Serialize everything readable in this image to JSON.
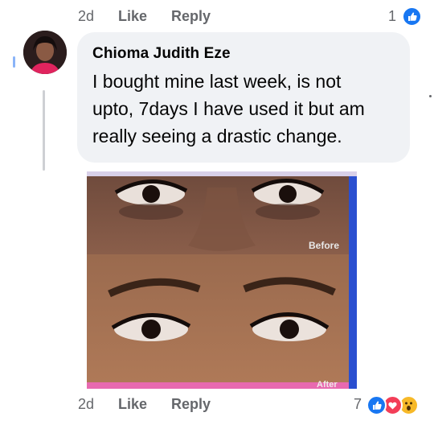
{
  "top_actions": {
    "time": "2d",
    "like": "Like",
    "reply": "Reply",
    "reaction_count": "1"
  },
  "comment": {
    "author": "Chioma Judith Eze",
    "text": "I bought mine last week, is not upto, 7days I have used it but am really seeing a drastic change.",
    "line1": "I bought mine last week, is not",
    "line2": "upto, 7days I have used it but am",
    "line3": "really seeing a drastic change.",
    "photo_labels": {
      "before": "Before",
      "after": "After"
    }
  },
  "bottom_actions": {
    "time": "2d",
    "like": "Like",
    "reply": "Reply",
    "reaction_count": "7"
  },
  "colors": {
    "like_blue": "#1877f2",
    "love_red": "#f33e58",
    "wow_yellow": "#f7b928",
    "bubble_bg": "#f0f2f5",
    "meta_gray": "#65676b"
  },
  "icons": [
    "like-reaction-icon",
    "love-reaction-icon",
    "wow-reaction-icon"
  ]
}
